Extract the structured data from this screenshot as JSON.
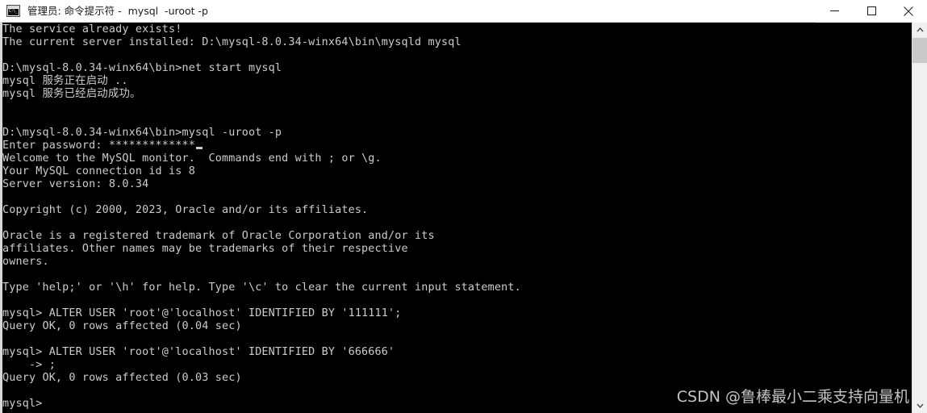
{
  "window": {
    "title": "管理员: 命令提示符 -  mysql  -uroot -p",
    "icon": "command-prompt-icon",
    "icon_text": "C:\\_",
    "controls": {
      "minimize": "minimize",
      "maximize": "maximize",
      "close": "close"
    }
  },
  "terminal": {
    "lines": [
      "The service already exists!",
      "The current server installed: D:\\mysql-8.0.34-winx64\\bin\\mysqld mysql",
      "",
      "D:\\mysql-8.0.34-winx64\\bin>net start mysql",
      "mysql 服务正在启动 ..",
      "mysql 服务已经启动成功。",
      "",
      "",
      "D:\\mysql-8.0.34-winx64\\bin>mysql -uroot -p",
      "Enter password: *************",
      "Welcome to the MySQL monitor.  Commands end with ; or \\g.",
      "Your MySQL connection id is 8",
      "Server version: 8.0.34",
      "",
      "Copyright (c) 2000, 2023, Oracle and/or its affiliates.",
      "",
      "Oracle is a registered trademark of Oracle Corporation and/or its",
      "affiliates. Other names may be trademarks of their respective",
      "owners.",
      "",
      "Type 'help;' or '\\h' for help. Type '\\c' to clear the current input statement.",
      "",
      "mysql> ALTER USER 'root'@'localhost' IDENTIFIED BY '111111';",
      "Query OK, 0 rows affected (0.04 sec)",
      "",
      "mysql> ALTER USER 'root'@'localhost' IDENTIFIED BY '666666'",
      "    -> ;",
      "Query OK, 0 rows affected (0.03 sec)",
      "",
      "mysql>"
    ],
    "cursor_line_index": 9,
    "background_color": "#000000",
    "foreground_color": "#cccccc"
  },
  "watermark": {
    "text": "CSDN @鲁棒最小二乘支持向量机"
  },
  "scrollbar": {
    "up_arrow": "chevron-up",
    "down_arrow": "chevron-down"
  }
}
